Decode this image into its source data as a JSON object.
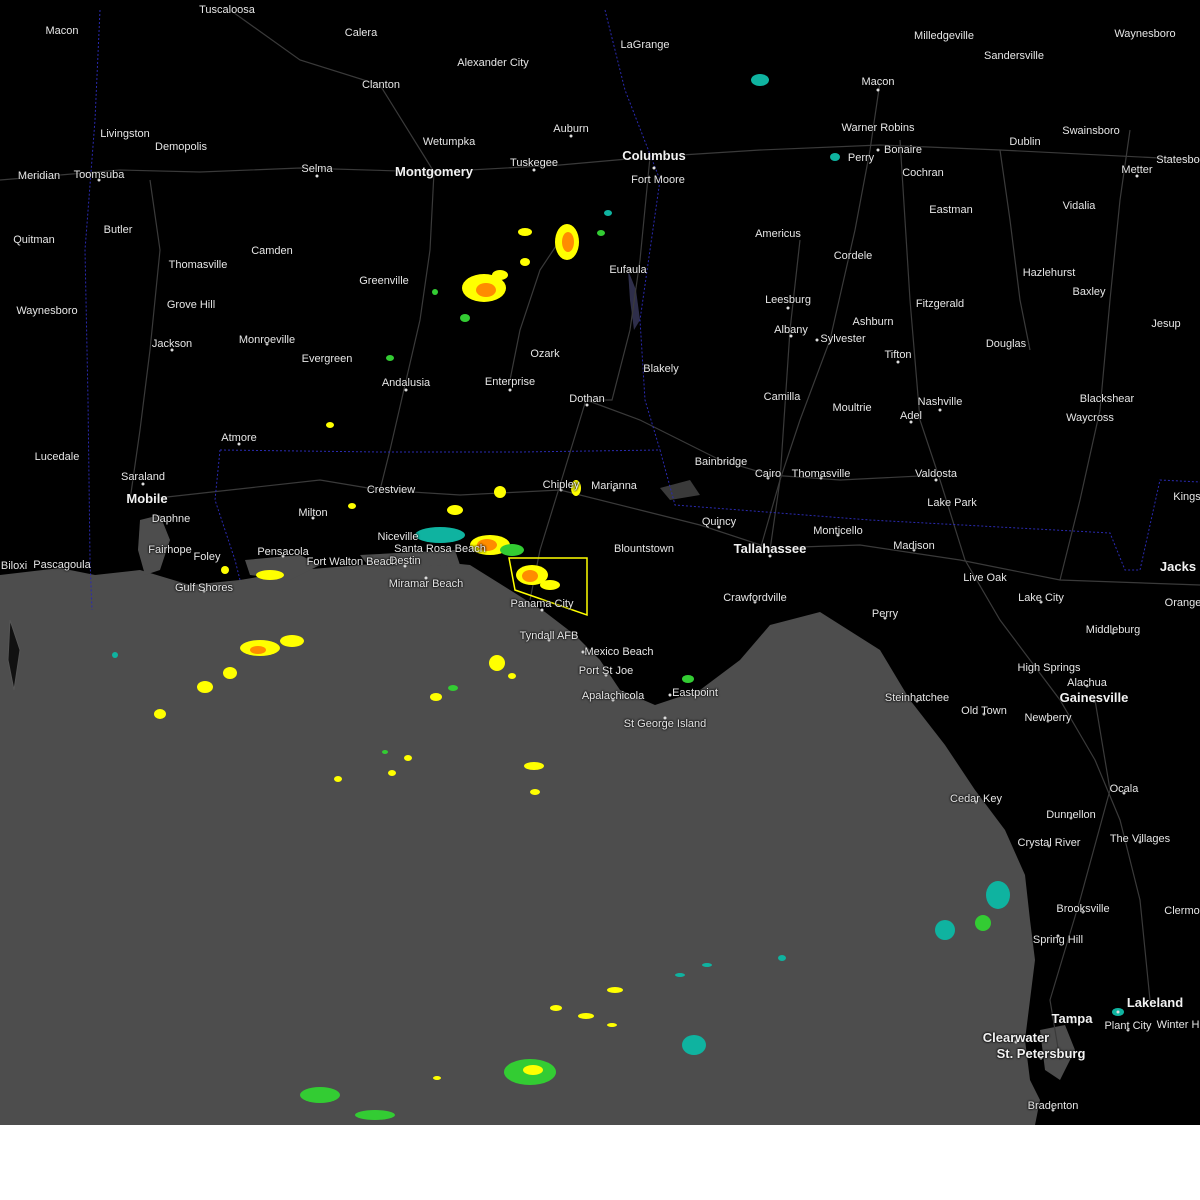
{
  "map": {
    "colors": {
      "land": "#000000",
      "water": "#4d4d4d",
      "roads": "#3a3a3a",
      "state_border": "#2a2ab0",
      "warning_polygon": "#ffff00",
      "radar_light": "#0fb3a0",
      "radar_mid": "#33cc33",
      "radar_heavy": "#ffff00",
      "radar_intense": "#ff8c00",
      "radar_extreme": "#e83b1e"
    },
    "cities": [
      {
        "name": "Tuscaloosa",
        "major": false
      },
      {
        "name": "Macon",
        "major": false
      },
      {
        "name": "Calera",
        "major": false
      },
      {
        "name": "LaGrange",
        "major": false
      },
      {
        "name": "Milledgeville",
        "major": false
      },
      {
        "name": "Waynesboro",
        "major": false
      },
      {
        "name": "Alexander City",
        "major": false
      },
      {
        "name": "Sandersville",
        "major": false
      },
      {
        "name": "Clanton",
        "major": false
      },
      {
        "name": "Macon",
        "major": false
      },
      {
        "name": "Auburn",
        "major": false
      },
      {
        "name": "Livingston",
        "major": false
      },
      {
        "name": "Warner Robins",
        "major": false
      },
      {
        "name": "Swainsboro",
        "major": false
      },
      {
        "name": "Demopolis",
        "major": false
      },
      {
        "name": "Wetumpka",
        "major": false
      },
      {
        "name": "Dublin",
        "major": false
      },
      {
        "name": "Columbus",
        "major": true
      },
      {
        "name": "Bonaire",
        "major": false
      },
      {
        "name": "Perry",
        "major": false
      },
      {
        "name": "Statesbo",
        "major": false
      },
      {
        "name": "Tuskegee",
        "major": false
      },
      {
        "name": "Selma",
        "major": false
      },
      {
        "name": "Montgomery",
        "major": true
      },
      {
        "name": "Meridian",
        "major": false
      },
      {
        "name": "Toomsuba",
        "major": false
      },
      {
        "name": "Cochran",
        "major": false
      },
      {
        "name": "Metter",
        "major": false
      },
      {
        "name": "Fort Moore",
        "major": false
      },
      {
        "name": "Eastman",
        "major": false
      },
      {
        "name": "Vidalia",
        "major": false
      },
      {
        "name": "Butler",
        "major": false
      },
      {
        "name": "Americus",
        "major": false
      },
      {
        "name": "Quitman",
        "major": false
      },
      {
        "name": "Camden",
        "major": false
      },
      {
        "name": "Cordele",
        "major": false
      },
      {
        "name": "Thomasville",
        "major": false
      },
      {
        "name": "Eufaula",
        "major": false
      },
      {
        "name": "Hazlehurst",
        "major": false
      },
      {
        "name": "Greenville",
        "major": false
      },
      {
        "name": "Baxley",
        "major": false
      },
      {
        "name": "Leesburg",
        "major": false
      },
      {
        "name": "Grove Hill",
        "major": false
      },
      {
        "name": "Fitzgerald",
        "major": false
      },
      {
        "name": "Waynesboro",
        "major": false
      },
      {
        "name": "Ashburn",
        "major": false
      },
      {
        "name": "Albany",
        "major": false
      },
      {
        "name": "Jesup",
        "major": false
      },
      {
        "name": "Monroeville",
        "major": false
      },
      {
        "name": "Sylvester",
        "major": false
      },
      {
        "name": "Jackson",
        "major": false
      },
      {
        "name": "Douglas",
        "major": false
      },
      {
        "name": "Ozark",
        "major": false
      },
      {
        "name": "Tifton",
        "major": false
      },
      {
        "name": "Evergreen",
        "major": false
      },
      {
        "name": "Blakely",
        "major": false
      },
      {
        "name": "Andalusia",
        "major": false
      },
      {
        "name": "Enterprise",
        "major": false
      },
      {
        "name": "Camilla",
        "major": false
      },
      {
        "name": "Nashville",
        "major": false
      },
      {
        "name": "Blackshear",
        "major": false
      },
      {
        "name": "Dothan",
        "major": false
      },
      {
        "name": "Moultrie",
        "major": false
      },
      {
        "name": "Adel",
        "major": false
      },
      {
        "name": "Waycross",
        "major": false
      },
      {
        "name": "Atmore",
        "major": false
      },
      {
        "name": "Lucedale",
        "major": false
      },
      {
        "name": "Bainbridge",
        "major": false
      },
      {
        "name": "Saraland",
        "major": false
      },
      {
        "name": "Cairo",
        "major": false
      },
      {
        "name": "Thomasville",
        "major": false
      },
      {
        "name": "Valdosta",
        "major": false
      },
      {
        "name": "Crestview",
        "major": false
      },
      {
        "name": "Chipley",
        "major": false
      },
      {
        "name": "Marianna",
        "major": false
      },
      {
        "name": "Mobile",
        "major": true
      },
      {
        "name": "Kings",
        "major": false
      },
      {
        "name": "Lake Park",
        "major": false
      },
      {
        "name": "Milton",
        "major": false
      },
      {
        "name": "Daphne",
        "major": false
      },
      {
        "name": "Quincy",
        "major": false
      },
      {
        "name": "Monticello",
        "major": false
      },
      {
        "name": "Niceville",
        "major": false
      },
      {
        "name": "Fairhope",
        "major": false
      },
      {
        "name": "Blountstown",
        "major": false
      },
      {
        "name": "Tallahassee",
        "major": true
      },
      {
        "name": "Madison",
        "major": false
      },
      {
        "name": "Santa Rosa Beach",
        "major": false
      },
      {
        "name": "Pensacola",
        "major": false
      },
      {
        "name": "Fort Walton Beach",
        "major": false
      },
      {
        "name": "Foley",
        "major": false
      },
      {
        "name": "Destin",
        "major": false
      },
      {
        "name": "Biloxi",
        "major": false
      },
      {
        "name": "Pascagoula",
        "major": false
      },
      {
        "name": "Live Oak",
        "major": false
      },
      {
        "name": "Jacks",
        "major": true
      },
      {
        "name": "Miramar Beach",
        "major": false
      },
      {
        "name": "Gulf Shores",
        "major": false
      },
      {
        "name": "Crawfordville",
        "major": false
      },
      {
        "name": "Lake City",
        "major": false
      },
      {
        "name": "Orange",
        "major": false
      },
      {
        "name": "Panama City",
        "major": false
      },
      {
        "name": "Perry",
        "major": false
      },
      {
        "name": "Middleburg",
        "major": false
      },
      {
        "name": "Tyndall AFB",
        "major": false
      },
      {
        "name": "Mexico Beach",
        "major": false
      },
      {
        "name": "High Springs",
        "major": false
      },
      {
        "name": "Alachua",
        "major": false
      },
      {
        "name": "Port St Joe",
        "major": false
      },
      {
        "name": "Gainesville",
        "major": true
      },
      {
        "name": "Eastpoint",
        "major": false
      },
      {
        "name": "Apalachicola",
        "major": false
      },
      {
        "name": "Steinhatchee",
        "major": false
      },
      {
        "name": "Old Town",
        "major": false
      },
      {
        "name": "Newberry",
        "major": false
      },
      {
        "name": "St George Island",
        "major": false
      },
      {
        "name": "Cedar Key",
        "major": false
      },
      {
        "name": "Ocala",
        "major": false
      },
      {
        "name": "Dunnellon",
        "major": false
      },
      {
        "name": "Crystal River",
        "major": false
      },
      {
        "name": "The Villages",
        "major": false
      },
      {
        "name": "Brooksville",
        "major": false
      },
      {
        "name": "Clermo",
        "major": false
      },
      {
        "name": "Spring Hill",
        "major": false
      },
      {
        "name": "Lakeland",
        "major": true
      },
      {
        "name": "Tampa",
        "major": true
      },
      {
        "name": "Plant City",
        "major": false
      },
      {
        "name": "Winter H",
        "major": false
      },
      {
        "name": "Clearwater",
        "major": true
      },
      {
        "name": "St. Petersburg",
        "major": true
      },
      {
        "name": "Bradenton",
        "major": false
      }
    ]
  }
}
